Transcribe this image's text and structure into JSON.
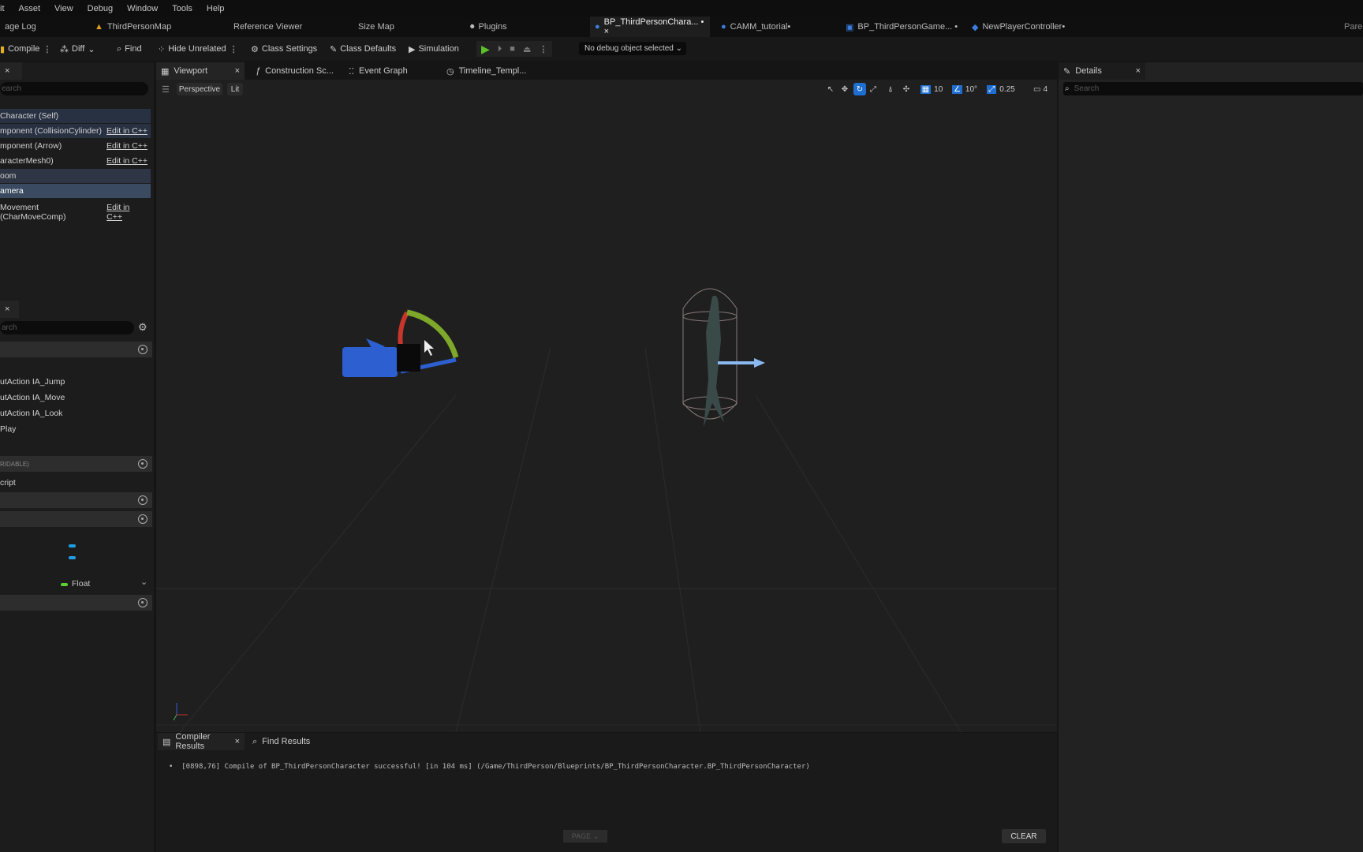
{
  "menu": [
    "it",
    "Asset",
    "View",
    "Debug",
    "Window",
    "Tools",
    "Help"
  ],
  "doc_tabs": [
    {
      "label": "age Log",
      "icon": "none",
      "active": false
    },
    {
      "label": "ThirdPersonMap",
      "icon": "level-icon",
      "active": false
    },
    {
      "label": "Reference Viewer",
      "icon": "none",
      "active": false
    },
    {
      "label": "Size Map",
      "icon": "none",
      "active": false
    },
    {
      "label": "Plugins",
      "icon": "plugin-icon",
      "active": false
    },
    {
      "label": "BP_ThirdPersonChara... • ×",
      "icon": "character-icon",
      "active": true
    },
    {
      "label": "CAMM_tutorial•",
      "icon": "character-icon",
      "active": false
    },
    {
      "label": "BP_ThirdPersonGame... •",
      "icon": "gamemode-icon",
      "active": false
    },
    {
      "label": "NewPlayerController•",
      "icon": "controller-icon",
      "active": false
    }
  ],
  "parent_label": "Pare",
  "toolbar": {
    "compile": "Compile",
    "diff": "Diff",
    "find": "Find",
    "hide_unrelated": "Hide Unrelated",
    "class_settings": "Class Settings",
    "class_defaults": "Class Defaults",
    "simulation": "Simulation",
    "debug_select": "No debug object selected"
  },
  "components": {
    "rows": [
      {
        "label": "Character (Self)",
        "link": "",
        "style": "hl"
      },
      {
        "label": "mponent (CollisionCylinder)",
        "link": "Edit in C++",
        "style": "hl"
      },
      {
        "label": "mponent (Arrow)",
        "link": "Edit in C++",
        "style": ""
      },
      {
        "label": "aracterMesh0)",
        "link": "Edit in C++",
        "style": ""
      },
      {
        "label": "oom",
        "link": "",
        "style": "sel"
      },
      {
        "label": "amera",
        "link": "",
        "style": "sel2"
      },
      {
        "label": "Movement (CharMoveComp)",
        "link": "Edit in C++",
        "style": ""
      }
    ],
    "search_placeholder": "earch"
  },
  "my_blueprint": {
    "search_placeholder": "arch",
    "graph_items": [
      "utAction IA_Jump",
      "utAction IA_Move",
      "utAction IA_Look",
      "Play"
    ],
    "section_overridable": "RIDABLE)",
    "script_item": "cript",
    "float_type": "Float"
  },
  "viewport_tabs": [
    {
      "label": "Viewport",
      "icon": "viewport-icon"
    },
    {
      "label": "Construction Sc...",
      "icon": "function-icon"
    },
    {
      "label": "Event Graph",
      "icon": "graph-icon"
    },
    {
      "label": "Timeline_Templ...",
      "icon": "clock-icon"
    }
  ],
  "viewport": {
    "perspective": "Perspective",
    "lit": "Lit",
    "grid_snap": "10",
    "rot_snap": "10°",
    "scale_snap": "0.25",
    "camera_speed": "4"
  },
  "details": {
    "title": "Details",
    "search_placeholder": "Search"
  },
  "bottom": {
    "tabs": [
      "Compiler Results",
      "Find Results"
    ],
    "log": "[0898,76] Compile of BP_ThirdPersonCharacter successful! [in 104 ms] (/Game/ThirdPerson/Blueprints/BP_ThirdPersonCharacter.BP_ThirdPersonCharacter)",
    "page": "PAGE",
    "clear": "CLEAR"
  },
  "colors": {
    "accent": "#1f6fd0",
    "play": "#5cc02a"
  }
}
